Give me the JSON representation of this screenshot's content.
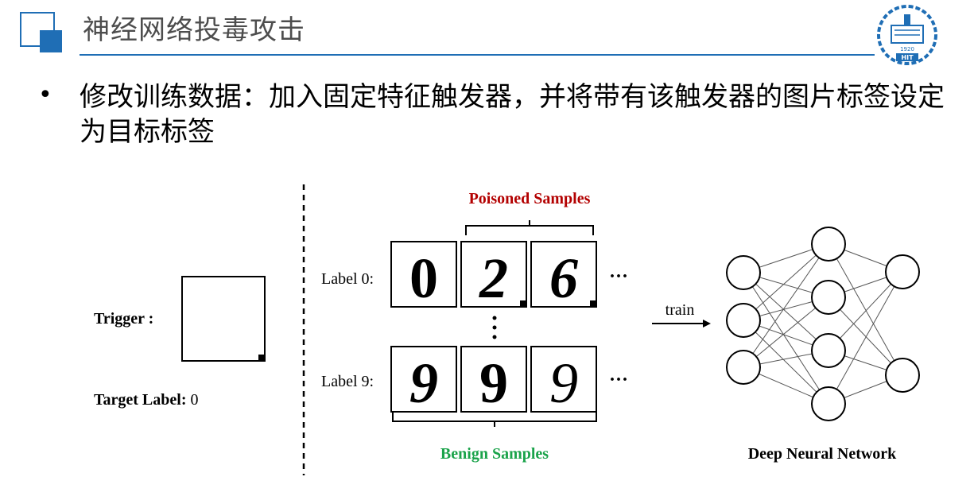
{
  "header": {
    "title": "神经网络投毒攻击",
    "logo_text": "HIT",
    "logo_year": "1920",
    "accent_color": "#1f6eb5"
  },
  "bullet": {
    "text": "修改训练数据：加入固定特征触发器，并将带有该触发器的图片标签设定为目标标签"
  },
  "diagram": {
    "trigger_label": "Trigger :",
    "target_label_bold": "Target Label:",
    "target_label_value": "0",
    "poisoned_title": "Poisoned Samples",
    "poisoned_color": "#b30000",
    "benign_title": "Benign Samples",
    "benign_color": "#1aa34a",
    "row0_label": "Label 0:",
    "row9_label": "Label 9:",
    "row0_digits": [
      "0",
      "2",
      "6"
    ],
    "row9_digits": [
      "9",
      "9",
      "9"
    ],
    "ellipsis": "···",
    "vertical_ellipsis": "⋮",
    "train_label": "train",
    "network_title": "Deep Neural Network"
  }
}
